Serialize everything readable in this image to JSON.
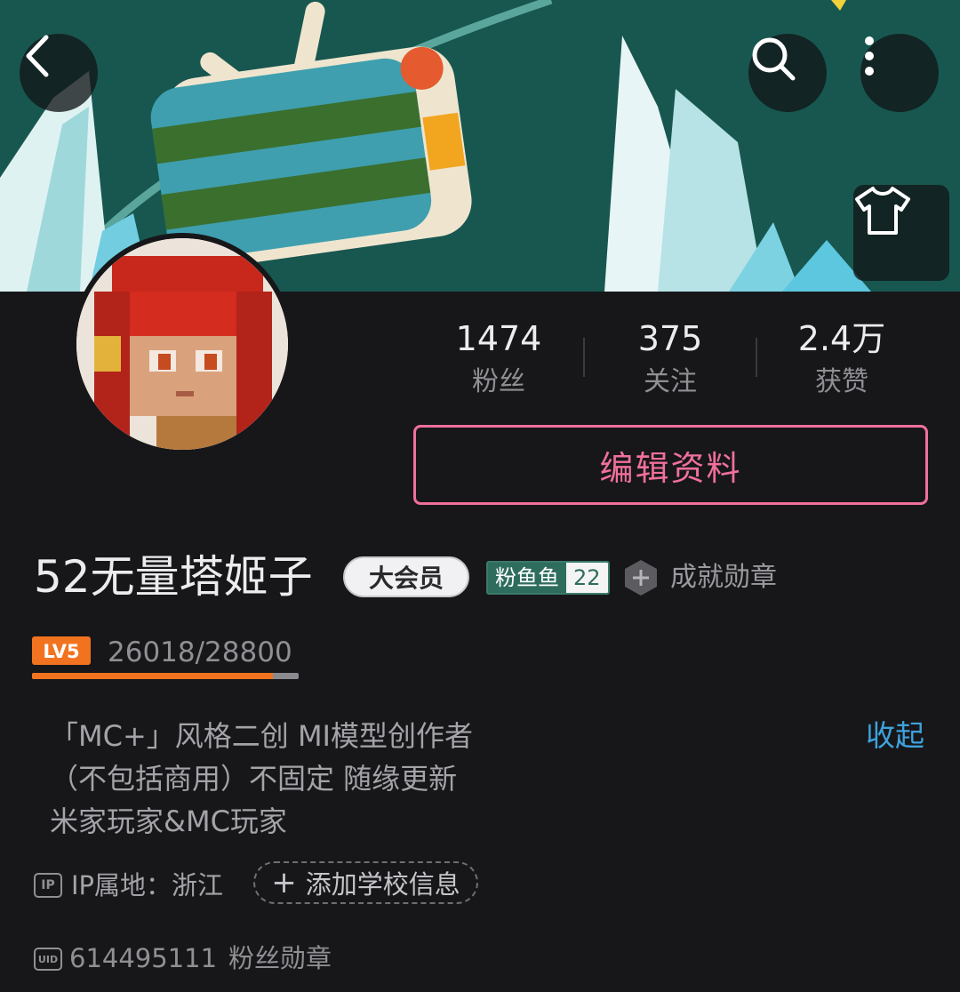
{
  "header": {
    "back_icon": "chevron-left-icon",
    "search_icon": "search-icon",
    "more_icon": "more-vertical-icon",
    "outfit_icon": "tshirt-icon"
  },
  "profile": {
    "name": "52无量塔姬子",
    "vip_label": "大会员",
    "fan_badge": {
      "name": "粉鱼鱼",
      "level": "22"
    },
    "achievement_label": "成就勋章",
    "level_badge": "LV5",
    "exp_text": "26018/28800",
    "exp_progress": 0.903
  },
  "stats": [
    {
      "value": "1474",
      "label": "粉丝"
    },
    {
      "value": "375",
      "label": "关注"
    },
    {
      "value": "2.4万",
      "label": "获赞"
    }
  ],
  "edit_button_label": "编辑资料",
  "bio": {
    "lines": [
      "「MC+」风格二创 MI模型创作者",
      "（不包括商用）不固定 随缘更新",
      "米家玩家&MC玩家"
    ],
    "collapse_label": "收起"
  },
  "ip": {
    "icon_text": "IP",
    "label": "IP属地：浙江"
  },
  "school_button_label": "添加学校信息",
  "uid": {
    "icon_text": "UID",
    "value": "614495111"
  },
  "fan_medal_label": "粉丝勋章",
  "colors": {
    "accent_pink": "#f0709a",
    "link_blue": "#3ea3dd",
    "level_orange": "#f2731f",
    "fan_badge_green": "#2e6d5d"
  }
}
